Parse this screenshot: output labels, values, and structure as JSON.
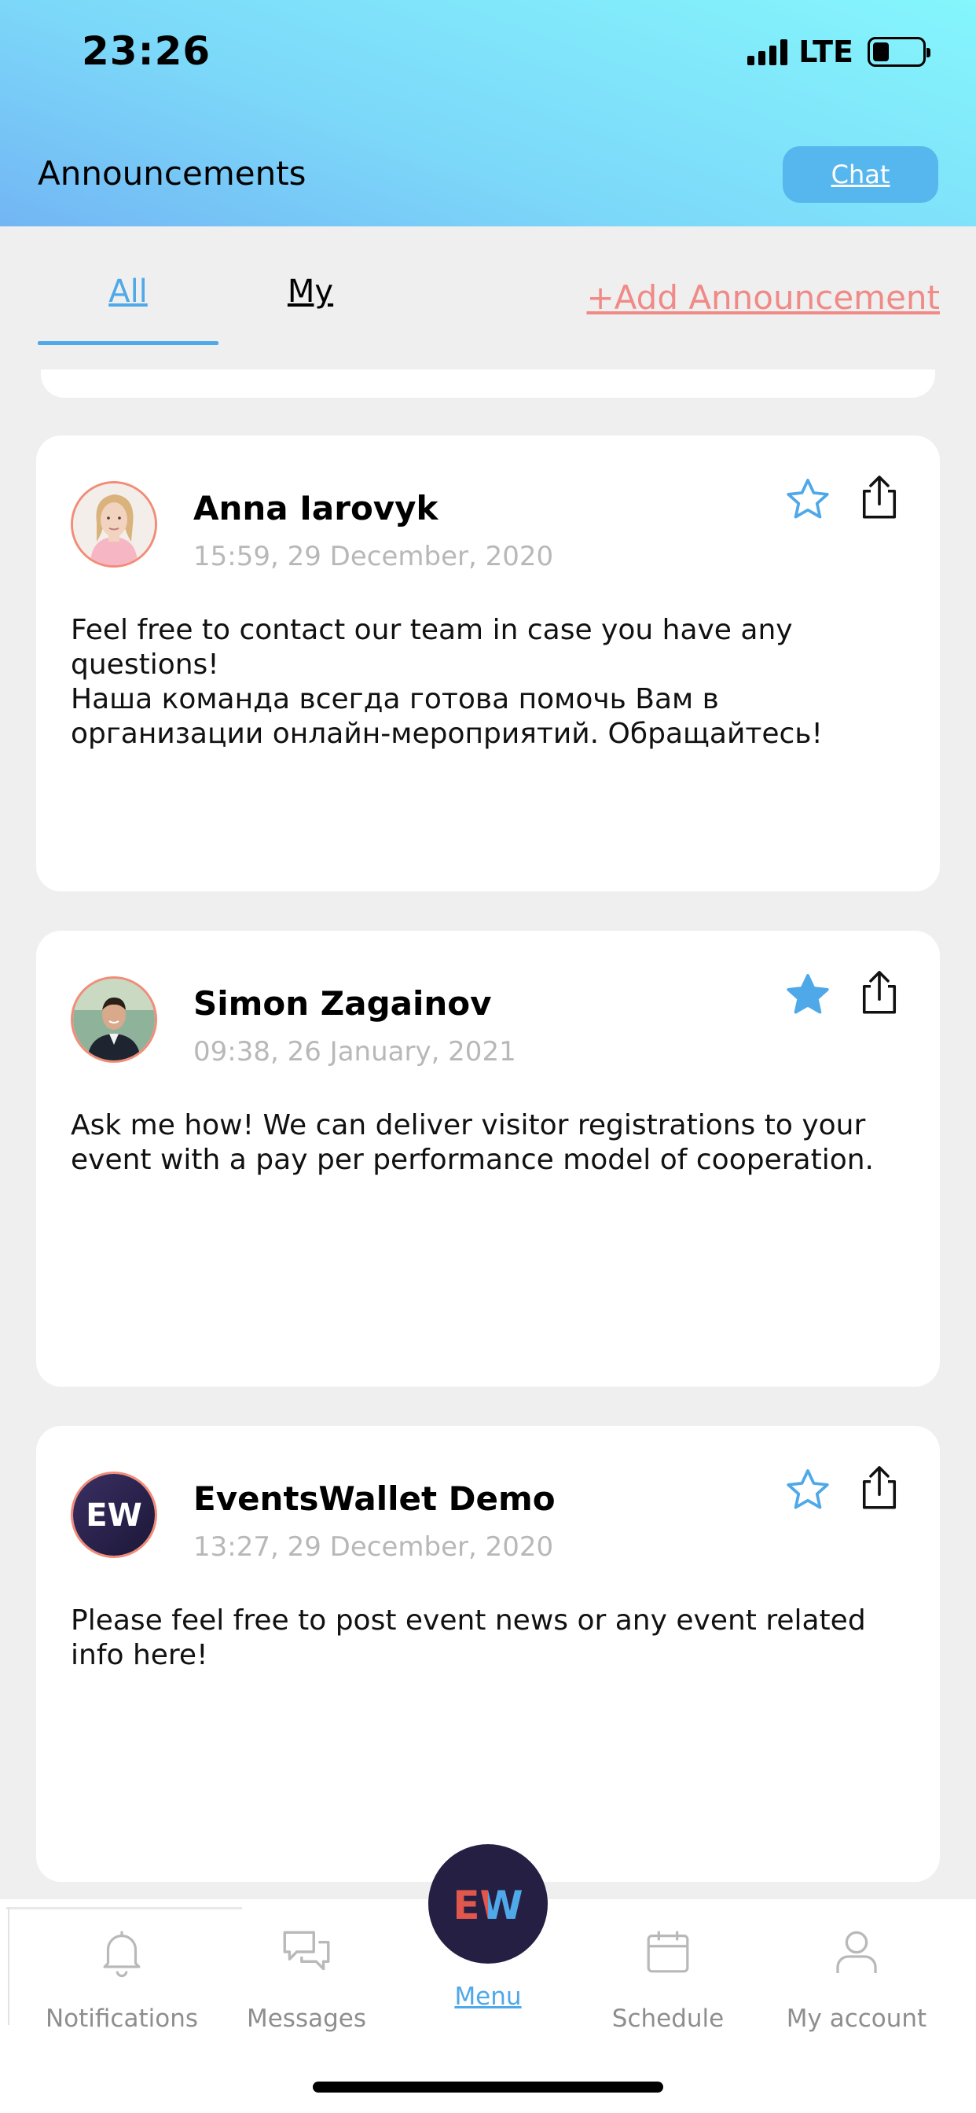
{
  "status_bar": {
    "time": "23:26",
    "network": "LTE"
  },
  "header": {
    "title": "Announcements",
    "chat_label": "Chat"
  },
  "tabs": {
    "all": "All",
    "my": "My",
    "add_announcement": "+Add Announcement",
    "active": "All"
  },
  "announcements": [
    {
      "author": "Anna Iarovyk",
      "timestamp": "15:59, 29 December, 2020",
      "text": "Feel free to contact our team in case you have any questions!\nНаша команда всегда готова помочь Вам в организации онлайн-мероприятий. Обращайтесь!",
      "starred": false
    },
    {
      "author": "Simon Zagainov",
      "timestamp": "09:38, 26 January, 2021",
      "text": "Ask me how! We can deliver visitor registrations to your event with a pay per performance model of cooperation.",
      "starred": true
    },
    {
      "author": "EventsWallet Demo",
      "timestamp": "13:27, 29 December, 2020",
      "text": "Please feel free to post event news or any event related info here!",
      "starred": false
    }
  ],
  "bottom_nav": {
    "notifications": "Notifications",
    "messages": "Messages",
    "menu": "Menu",
    "schedule": "Schedule",
    "my_account": "My account",
    "logo_text": "EW"
  },
  "colors": {
    "accent_blue": "#4fa8e8",
    "add_link": "#f08a86",
    "star_filled": "#4fa8e8",
    "menu_circle": "#251f44"
  }
}
